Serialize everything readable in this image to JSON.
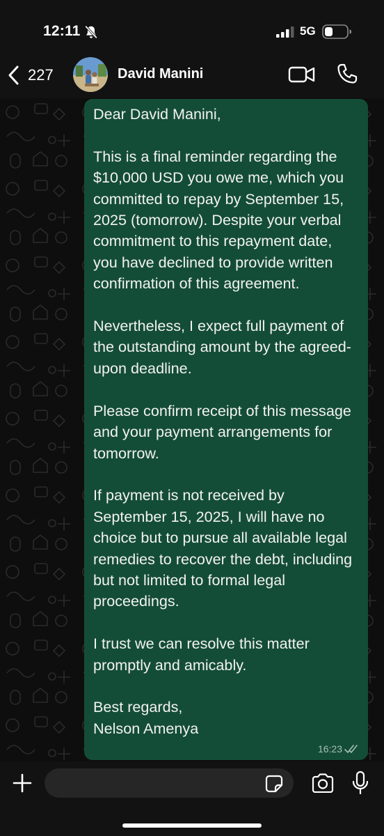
{
  "status_bar": {
    "time": "12:11",
    "network": "5G",
    "icons": [
      "bell-slash-icon",
      "signal-bars-icon",
      "battery-icon"
    ]
  },
  "header": {
    "back_count": "227",
    "contact_name": "David Manini",
    "icons": [
      "chevron-left-icon",
      "video-call-icon",
      "phone-call-icon"
    ]
  },
  "message": {
    "text": "Dear David Manini,\n\nThis is a final reminder regarding the $10,000 USD you owe me, which you committed to repay by September 15, 2025 (tomorrow). Despite your verbal commitment to this repayment date, you have declined to provide written confirmation of this agreement.\n\nNevertheless, I expect full payment of the outstanding amount by the agreed-upon deadline.\n\nPlease confirm receipt of this message and your payment arrangements for tomorrow.\n\nIf payment is not received by September 15, 2025, I will have no choice but to pursue all available legal remedies to recover the debt, including but not limited to formal legal proceedings.\n\nI trust we can resolve this matter promptly and amicably.\n\nBest regards,\nNelson Amenya",
    "time": "16:23",
    "status": "read",
    "bubble_color": "#144d37"
  },
  "composer": {
    "placeholder": "",
    "icons": [
      "plus-icon",
      "sticker-icon",
      "camera-icon",
      "microphone-icon"
    ]
  },
  "colors": {
    "background": "#0e0e0e",
    "bar": "#121212",
    "outgoing_bubble": "#144d37",
    "input": "#262626"
  }
}
